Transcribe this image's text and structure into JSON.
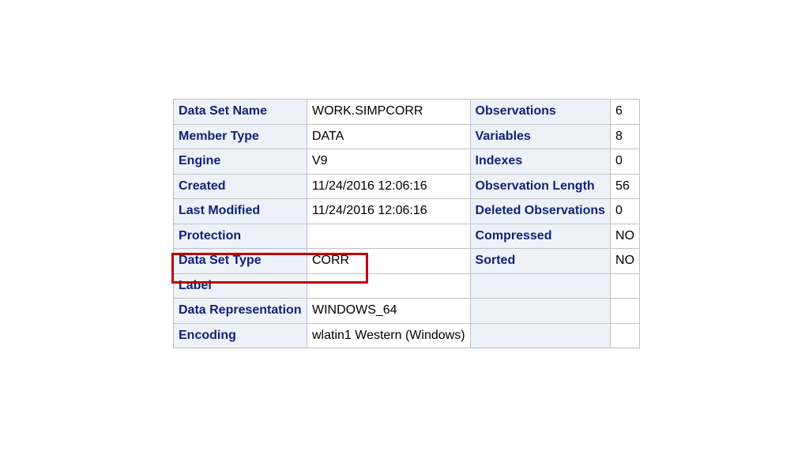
{
  "table": {
    "rows": [
      {
        "l1": "Data Set Name",
        "v1": "WORK.SIMPCORR",
        "l2": "Observations",
        "v2": "6"
      },
      {
        "l1": "Member Type",
        "v1": "DATA",
        "l2": "Variables",
        "v2": "8"
      },
      {
        "l1": "Engine",
        "v1": "V9",
        "l2": "Indexes",
        "v2": "0"
      },
      {
        "l1": "Created",
        "v1": "11/24/2016 12:06:16",
        "l2": "Observation Length",
        "v2": "56"
      },
      {
        "l1": "Last Modified",
        "v1": "11/24/2016 12:06:16",
        "l2": "Deleted Observations",
        "v2": "0"
      },
      {
        "l1": "Protection",
        "v1": "",
        "l2": "Compressed",
        "v2": "NO"
      },
      {
        "l1": "Data Set Type",
        "v1": "CORR",
        "l2": "Sorted",
        "v2": "NO"
      },
      {
        "l1": "Label",
        "v1": "",
        "l2": "",
        "v2": ""
      },
      {
        "l1": "Data Representation",
        "v1": "WINDOWS_64",
        "l2": "",
        "v2": ""
      },
      {
        "l1": "Encoding",
        "v1": "wlatin1 Western (Windows)",
        "l2": "",
        "v2": ""
      }
    ]
  },
  "colors": {
    "label_text": "#112277",
    "label_bg": "#edf2f9",
    "grid": "#c1c1c1",
    "highlight": "#c00000"
  }
}
